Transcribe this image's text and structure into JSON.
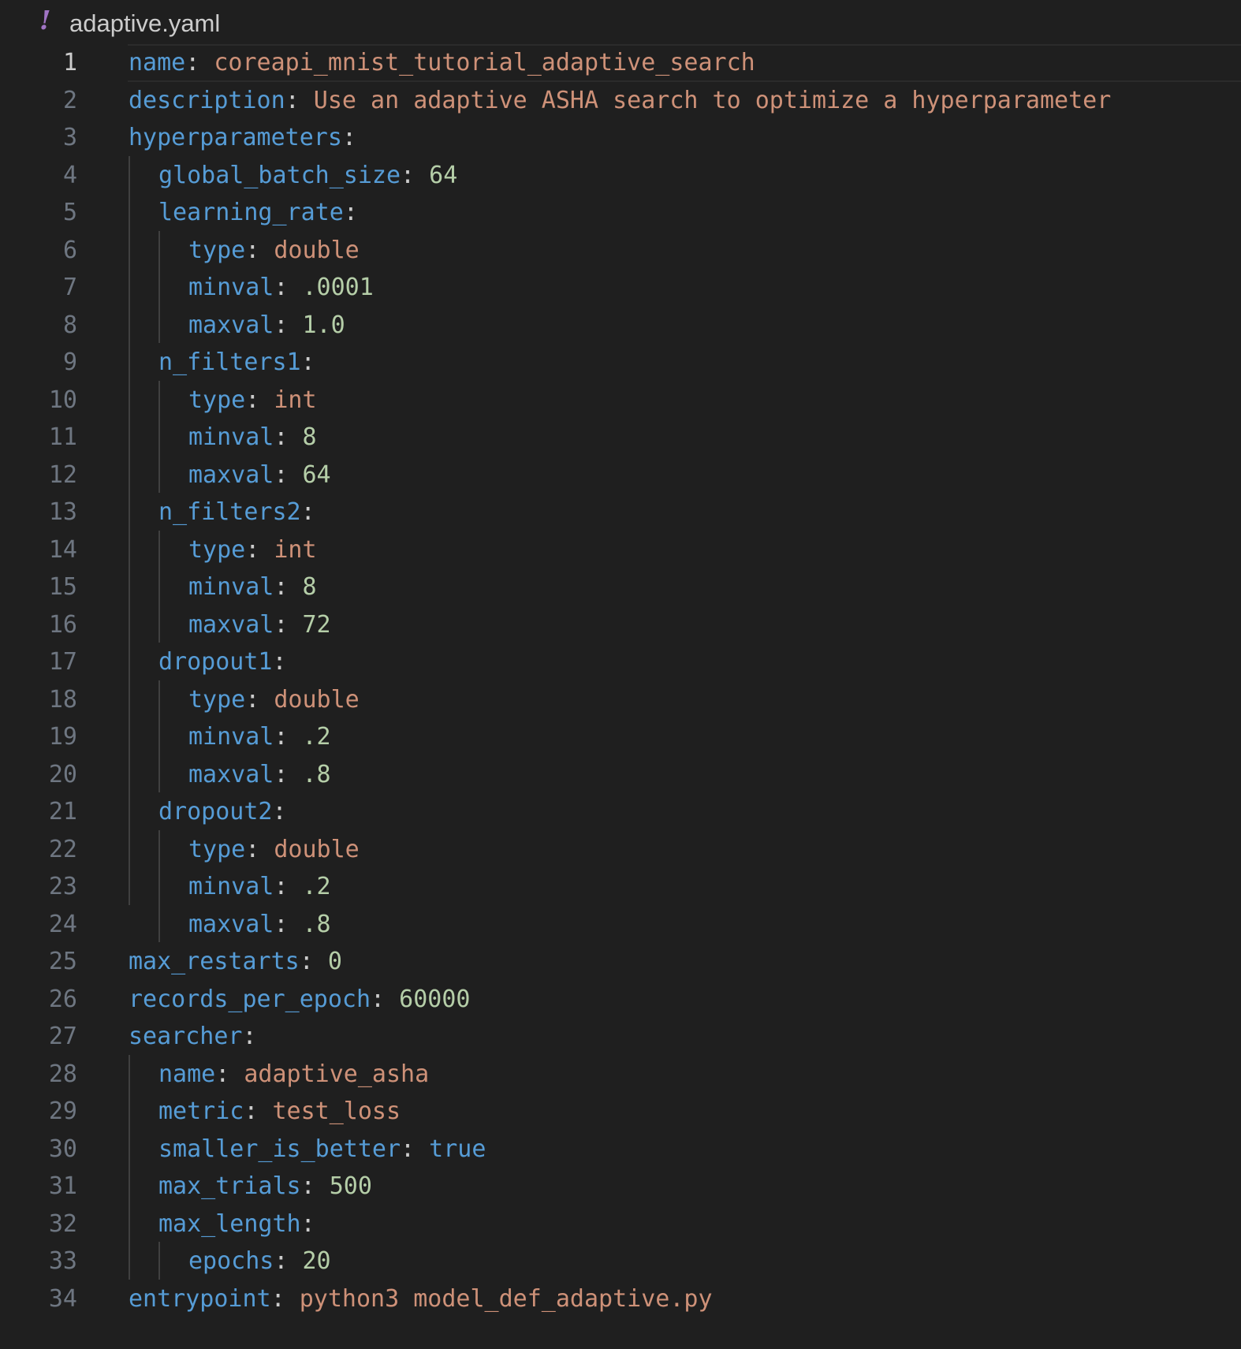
{
  "tab": {
    "icon": "yaml-exclamation-icon",
    "filename": "adaptive.yaml"
  },
  "editor": {
    "current_line": 1,
    "lines": [
      {
        "number": "1",
        "key": "name",
        "colon": ":",
        "value": " coreapi_mnist_tutorial_adaptive_search"
      },
      {
        "number": "2",
        "key": "description",
        "colon": ":",
        "value": " Use an adaptive ASHA search to optimize a hyperparameter"
      },
      {
        "number": "3",
        "key": "hyperparameters",
        "colon": ":",
        "value": ""
      },
      {
        "number": "4",
        "key": "global_batch_size",
        "colon": ":",
        "value": " 64"
      },
      {
        "number": "5",
        "key": "learning_rate",
        "colon": ":",
        "value": ""
      },
      {
        "number": "6",
        "key": "type",
        "colon": ":",
        "value": " double"
      },
      {
        "number": "7",
        "key": "minval",
        "colon": ":",
        "value": " .0001"
      },
      {
        "number": "8",
        "key": "maxval",
        "colon": ":",
        "value": " 1.0"
      },
      {
        "number": "9",
        "key": "n_filters1",
        "colon": ":",
        "value": ""
      },
      {
        "number": "10",
        "key": "type",
        "colon": ":",
        "value": " int"
      },
      {
        "number": "11",
        "key": "minval",
        "colon": ":",
        "value": " 8"
      },
      {
        "number": "12",
        "key": "maxval",
        "colon": ":",
        "value": " 64"
      },
      {
        "number": "13",
        "key": "n_filters2",
        "colon": ":",
        "value": ""
      },
      {
        "number": "14",
        "key": "type",
        "colon": ":",
        "value": " int"
      },
      {
        "number": "15",
        "key": "minval",
        "colon": ":",
        "value": " 8"
      },
      {
        "number": "16",
        "key": "maxval",
        "colon": ":",
        "value": " 72"
      },
      {
        "number": "17",
        "key": "dropout1",
        "colon": ":",
        "value": ""
      },
      {
        "number": "18",
        "key": "type",
        "colon": ":",
        "value": " double"
      },
      {
        "number": "19",
        "key": "minval",
        "colon": ":",
        "value": " .2"
      },
      {
        "number": "20",
        "key": "maxval",
        "colon": ":",
        "value": " .8"
      },
      {
        "number": "21",
        "key": "dropout2",
        "colon": ":",
        "value": ""
      },
      {
        "number": "22",
        "key": "type",
        "colon": ":",
        "value": " double"
      },
      {
        "number": "23",
        "key": "minval",
        "colon": ":",
        "value": " .2"
      },
      {
        "number": "24",
        "key": "maxval",
        "colon": ":",
        "value": " .8"
      },
      {
        "number": "25",
        "key": "max_restarts",
        "colon": ":",
        "value": " 0"
      },
      {
        "number": "26",
        "key": "records_per_epoch",
        "colon": ":",
        "value": " 60000"
      },
      {
        "number": "27",
        "key": "searcher",
        "colon": ":",
        "value": ""
      },
      {
        "number": "28",
        "key": "name",
        "colon": ":",
        "value": " adaptive_asha"
      },
      {
        "number": "29",
        "key": "metric",
        "colon": ":",
        "value": " test_loss"
      },
      {
        "number": "30",
        "key": "smaller_is_better",
        "colon": ":",
        "value": " true"
      },
      {
        "number": "31",
        "key": "max_trials",
        "colon": ":",
        "value": " 500"
      },
      {
        "number": "32",
        "key": "max_length",
        "colon": ":",
        "value": ""
      },
      {
        "number": "33",
        "key": "epochs",
        "colon": ":",
        "value": " 20"
      },
      {
        "number": "34",
        "key": "entrypoint",
        "colon": ":",
        "value": " python3 model_def_adaptive.py"
      }
    ]
  },
  "colors": {
    "background": "#1f1f1f",
    "key": "#569cd6",
    "string": "#ce9178",
    "number": "#b5cea8",
    "punctuation": "#cccccc",
    "line_number": "#6e7681",
    "yaml_icon": "#a074c4"
  }
}
